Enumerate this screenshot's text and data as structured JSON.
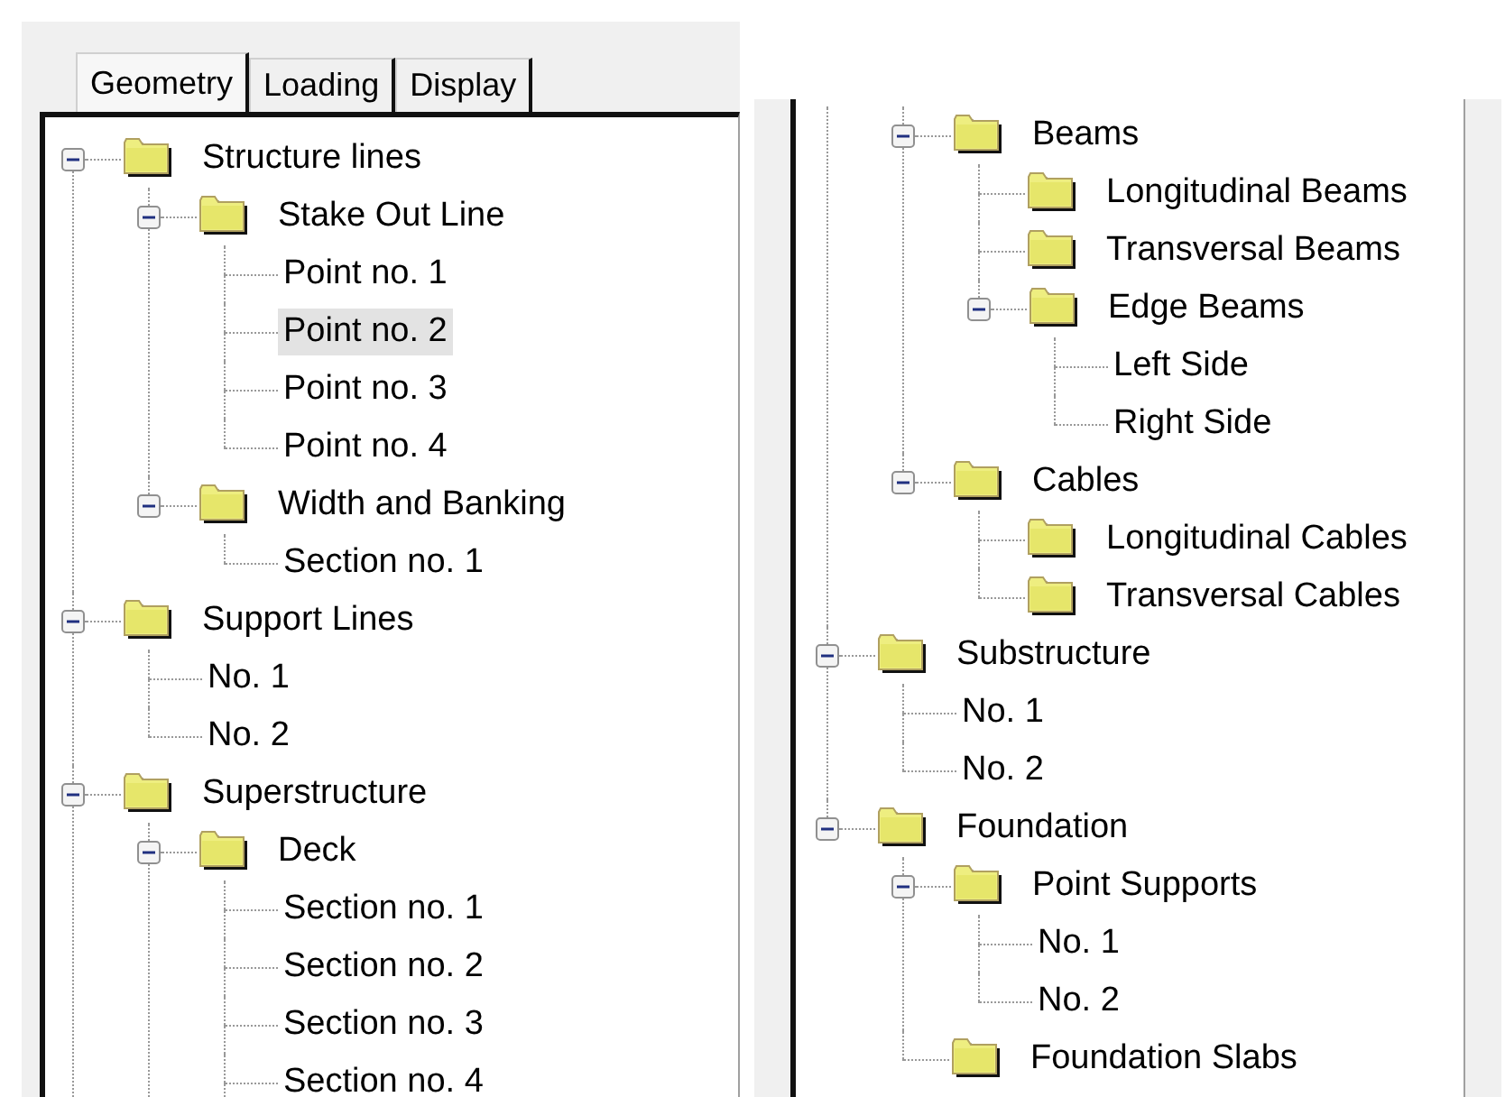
{
  "left_panel": {
    "tabs": [
      {
        "label": "Geometry",
        "selected": true
      },
      {
        "label": "Loading",
        "selected": false
      },
      {
        "label": "Display",
        "selected": false
      }
    ],
    "tree": {
      "continues_below": true,
      "items": [
        {
          "label": "Structure lines",
          "kind": "folder",
          "selected": false,
          "expanded": true,
          "children": [
            {
              "label": "Stake Out Line",
              "kind": "folder",
              "selected": false,
              "expanded": true,
              "children": [
                {
                  "label": "Point no. 1",
                  "kind": "leaf",
                  "selected": false
                },
                {
                  "label": "Point no. 2",
                  "kind": "leaf",
                  "selected": true
                },
                {
                  "label": "Point no. 3",
                  "kind": "leaf",
                  "selected": false
                },
                {
                  "label": "Point no. 4",
                  "kind": "leaf",
                  "selected": false
                }
              ]
            },
            {
              "label": "Width and Banking",
              "kind": "folder",
              "selected": false,
              "expanded": true,
              "children": [
                {
                  "label": "Section no. 1",
                  "kind": "leaf",
                  "selected": false
                }
              ]
            }
          ]
        },
        {
          "label": "Support Lines",
          "kind": "folder",
          "selected": false,
          "expanded": true,
          "children": [
            {
              "label": "No. 1",
              "kind": "leaf",
              "selected": false
            },
            {
              "label": "No. 2",
              "kind": "leaf",
              "selected": false
            }
          ]
        },
        {
          "label": "Superstructure",
          "kind": "folder",
          "selected": false,
          "expanded": true,
          "children": [
            {
              "label": "Deck",
              "kind": "folder",
              "selected": false,
              "expanded": true,
              "children": [
                {
                  "label": "Section no. 1",
                  "kind": "leaf",
                  "selected": false
                },
                {
                  "label": "Section no. 2",
                  "kind": "leaf",
                  "selected": false
                },
                {
                  "label": "Section no. 3",
                  "kind": "leaf",
                  "selected": false
                },
                {
                  "label": "Section no. 4",
                  "kind": "leaf",
                  "selected": false
                }
              ]
            }
          ]
        }
      ]
    }
  },
  "right_panel": {
    "tree": {
      "continued_from_above": true,
      "items": [
        {
          "children": [
            {
              "label": "Beams",
              "kind": "folder",
              "selected": false,
              "expanded": true,
              "children": [
                {
                  "label": "Longitudinal Beams",
                  "kind": "folder",
                  "selected": false
                },
                {
                  "label": "Transversal Beams",
                  "kind": "folder",
                  "selected": false
                },
                {
                  "label": "Edge Beams",
                  "kind": "folder",
                  "selected": false,
                  "expanded": true,
                  "children": [
                    {
                      "label": "Left Side",
                      "kind": "leaf",
                      "selected": false
                    },
                    {
                      "label": "Right Side",
                      "kind": "leaf",
                      "selected": false
                    }
                  ]
                }
              ]
            },
            {
              "label": "Cables",
              "kind": "folder",
              "selected": false,
              "expanded": true,
              "children": [
                {
                  "label": "Longitudinal Cables",
                  "kind": "folder",
                  "selected": false
                },
                {
                  "label": "Transversal Cables",
                  "kind": "folder",
                  "selected": false
                }
              ]
            }
          ]
        },
        {
          "label": "Substructure",
          "kind": "folder",
          "selected": false,
          "expanded": true,
          "children": [
            {
              "label": "No. 1",
              "kind": "leaf",
              "selected": false
            },
            {
              "label": "No. 2",
              "kind": "leaf",
              "selected": false
            }
          ]
        },
        {
          "label": "Foundation",
          "kind": "folder",
          "selected": false,
          "expanded": true,
          "children": [
            {
              "label": "Point Supports",
              "kind": "folder",
              "selected": false,
              "expanded": true,
              "children": [
                {
                  "label": "No. 1",
                  "kind": "leaf",
                  "selected": false
                },
                {
                  "label": "No. 2",
                  "kind": "leaf",
                  "selected": false
                }
              ]
            },
            {
              "label": "Foundation Slabs",
              "kind": "folder",
              "selected": false
            }
          ]
        }
      ]
    }
  }
}
